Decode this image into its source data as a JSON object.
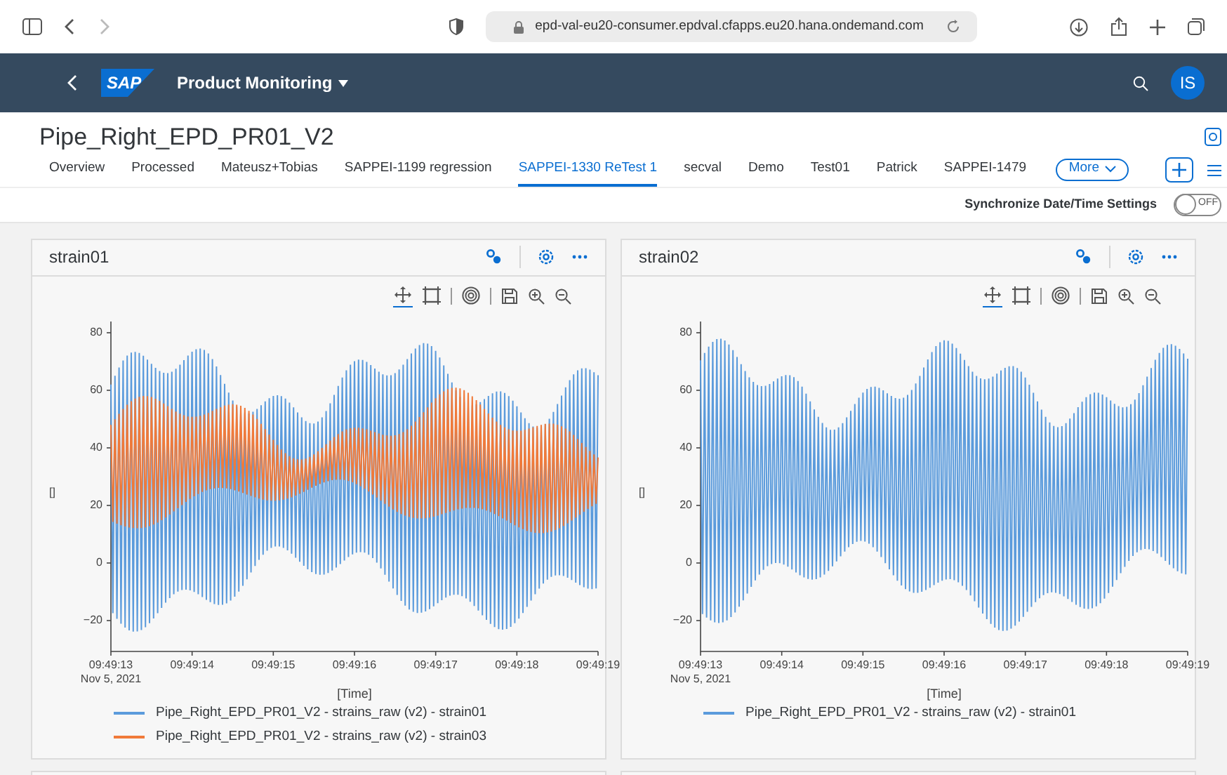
{
  "browser": {
    "url": "epd-val-eu20-consumer.epdval.cfapps.eu20.hana.ondemand.com"
  },
  "shell": {
    "logo": "SAP",
    "app_title": "Product Monitoring",
    "avatar": "IS"
  },
  "page": {
    "title": "Pipe_Right_EPD_PR01_V2"
  },
  "tabs": [
    {
      "label": "Overview",
      "selected": false
    },
    {
      "label": "Processed",
      "selected": false
    },
    {
      "label": "Mateusz+Tobias",
      "selected": false
    },
    {
      "label": "SAPPEI-1199 regression",
      "selected": false
    },
    {
      "label": "SAPPEI-1330 ReTest 1",
      "selected": true
    },
    {
      "label": "secval",
      "selected": false
    },
    {
      "label": "Demo",
      "selected": false
    },
    {
      "label": "Test01",
      "selected": false
    },
    {
      "label": "Patrick",
      "selected": false
    },
    {
      "label": "SAPPEI-1479",
      "selected": false
    }
  ],
  "more_button": "More",
  "sync": {
    "label": "Synchronize Date/Time Settings",
    "on": false,
    "state_text": "OFF"
  },
  "cards": [
    {
      "title": "strain01",
      "ylabel": "[]",
      "xlabel": "[Time]",
      "y_ticks": [
        "80",
        "60",
        "40",
        "20",
        "0",
        "−20"
      ],
      "x_ticks": [
        "09:49:13",
        "09:49:14",
        "09:49:15",
        "09:49:16",
        "09:49:17",
        "09:49:18",
        "09:49:19"
      ],
      "date": "Nov 5, 2021",
      "legend": [
        {
          "label": "Pipe_Right_EPD_PR01_V2 - strains_raw (v2) - strain01",
          "color": "#5b9bdc"
        },
        {
          "label": "Pipe_Right_EPD_PR01_V2 - strains_raw (v2) - strain03",
          "color": "#f07a3a"
        }
      ]
    },
    {
      "title": "strain02",
      "ylabel": "[]",
      "xlabel": "[Time]",
      "y_ticks": [
        "80",
        "60",
        "40",
        "20",
        "0",
        "−20"
      ],
      "x_ticks": [
        "09:49:13",
        "09:49:14",
        "09:49:15",
        "09:49:16",
        "09:49:17",
        "09:49:18",
        "09:49:19"
      ],
      "date": "Nov 5, 2021",
      "legend": [
        {
          "label": "Pipe_Right_EPD_PR01_V2 - strains_raw (v2) - strain01",
          "color": "#5b9bdc"
        }
      ]
    }
  ]
}
